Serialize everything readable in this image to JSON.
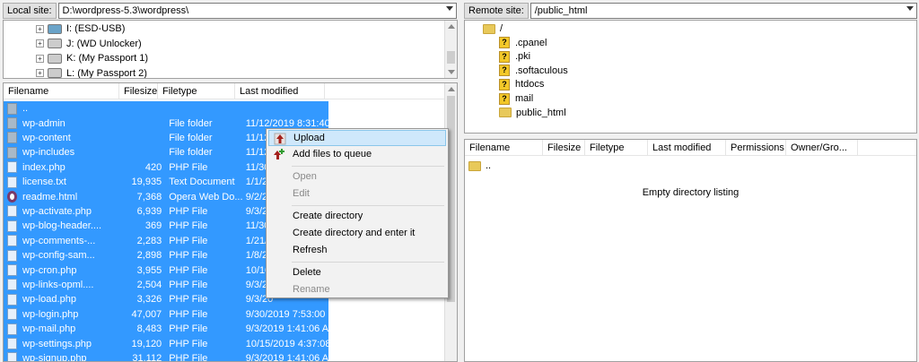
{
  "local": {
    "label": "Local site:",
    "path": "D:\\wordpress-5.3\\wordpress\\",
    "tree": [
      {
        "label": "I: (ESD-USB)",
        "icon": "usb-drive-icon"
      },
      {
        "label": "J: (WD Unlocker)",
        "icon": "drive-icon"
      },
      {
        "label": "K: (My Passport 1)",
        "icon": "drive-icon"
      },
      {
        "label": "L: (My Passport 2)",
        "icon": "drive-icon"
      }
    ],
    "columns": [
      "Filename",
      "Filesize",
      "Filetype",
      "Last modified"
    ],
    "files": [
      {
        "name": "..",
        "size": "",
        "type": "",
        "modified": "",
        "icon": "folder"
      },
      {
        "name": "wp-admin",
        "size": "",
        "type": "File folder",
        "modified": "11/12/2019 8:31:40...",
        "icon": "folder"
      },
      {
        "name": "wp-content",
        "size": "",
        "type": "File folder",
        "modified": "11/12",
        "icon": "folder"
      },
      {
        "name": "wp-includes",
        "size": "",
        "type": "File folder",
        "modified": "11/12",
        "icon": "folder"
      },
      {
        "name": "index.php",
        "size": "420",
        "type": "PHP File",
        "modified": "11/30",
        "icon": "file"
      },
      {
        "name": "license.txt",
        "size": "19,935",
        "type": "Text Document",
        "modified": "1/1/20",
        "icon": "file"
      },
      {
        "name": "readme.html",
        "size": "7,368",
        "type": "Opera Web Do...",
        "modified": "9/2/20",
        "icon": "opera"
      },
      {
        "name": "wp-activate.php",
        "size": "6,939",
        "type": "PHP File",
        "modified": "9/3/20",
        "icon": "file"
      },
      {
        "name": "wp-blog-header....",
        "size": "369",
        "type": "PHP File",
        "modified": "11/30",
        "icon": "file"
      },
      {
        "name": "wp-comments-...",
        "size": "2,283",
        "type": "PHP File",
        "modified": "1/21/2",
        "icon": "file"
      },
      {
        "name": "wp-config-sam...",
        "size": "2,898",
        "type": "PHP File",
        "modified": "1/8/20",
        "icon": "file"
      },
      {
        "name": "wp-cron.php",
        "size": "3,955",
        "type": "PHP File",
        "modified": "10/10",
        "icon": "file"
      },
      {
        "name": "wp-links-opml....",
        "size": "2,504",
        "type": "PHP File",
        "modified": "9/3/20",
        "icon": "file"
      },
      {
        "name": "wp-load.php",
        "size": "3,326",
        "type": "PHP File",
        "modified": "9/3/20",
        "icon": "file"
      },
      {
        "name": "wp-login.php",
        "size": "47,007",
        "type": "PHP File",
        "modified": "9/30/2019 7:53:00 ...",
        "icon": "file"
      },
      {
        "name": "wp-mail.php",
        "size": "8,483",
        "type": "PHP File",
        "modified": "9/3/2019 1:41:06 AM",
        "icon": "file"
      },
      {
        "name": "wp-settings.php",
        "size": "19,120",
        "type": "PHP File",
        "modified": "10/15/2019 4:37:08...",
        "icon": "file"
      },
      {
        "name": "wp-signup.php",
        "size": "31,112",
        "type": "PHP File",
        "modified": "9/3/2019 1:41:06 AM",
        "icon": "file"
      }
    ]
  },
  "remote": {
    "label": "Remote site:",
    "path": "/public_html",
    "tree": [
      {
        "label": "/",
        "icon": "folder-icon"
      },
      {
        "label": ".cpanel",
        "icon": "unknown-folder-icon"
      },
      {
        "label": ".pki",
        "icon": "unknown-folder-icon"
      },
      {
        "label": ".softaculous",
        "icon": "unknown-folder-icon"
      },
      {
        "label": "htdocs",
        "icon": "unknown-folder-icon"
      },
      {
        "label": "mail",
        "icon": "unknown-folder-icon"
      },
      {
        "label": "public_html",
        "icon": "folder-icon"
      }
    ],
    "columns": [
      "Filename",
      "Filesize",
      "Filetype",
      "Last modified",
      "Permissions",
      "Owner/Gro..."
    ],
    "parent": "..",
    "empty": "Empty directory listing"
  },
  "menu": {
    "upload": "Upload",
    "add_queue": "Add files to queue",
    "open": "Open",
    "edit": "Edit",
    "create_dir": "Create directory",
    "create_enter": "Create directory and enter it",
    "refresh": "Refresh",
    "delete": "Delete",
    "rename": "Rename"
  },
  "colors": {
    "selection": "#3399ff",
    "highlight": "#cfe8fb"
  }
}
